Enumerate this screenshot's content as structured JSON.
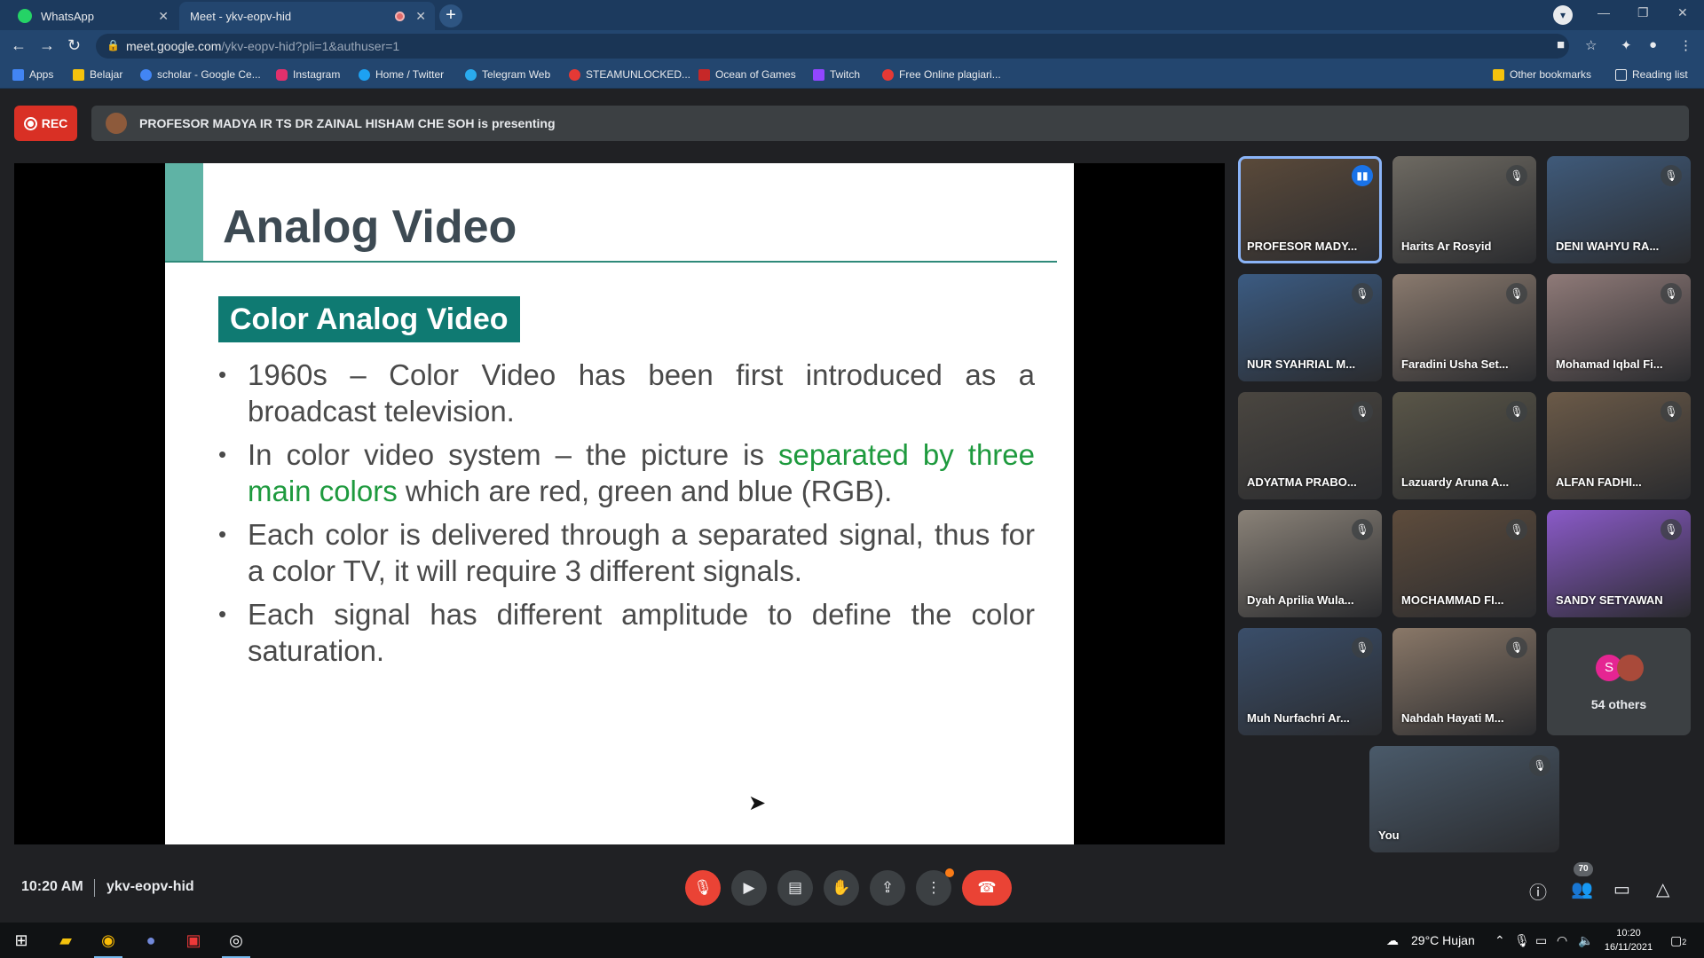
{
  "browser": {
    "tabs": [
      {
        "label": "WhatsApp",
        "active": false
      },
      {
        "label": "Meet - ykv-eopv-hid",
        "active": true
      }
    ],
    "address": {
      "host": "meet.google.com",
      "path": "/ykv-eopv-hid?pli=1&authuser=1"
    },
    "bookmarks": [
      {
        "label": "Apps",
        "color": "#4285f4"
      },
      {
        "label": "Belajar",
        "color": "#f4c20d"
      },
      {
        "label": "scholar - Google Ce...",
        "color": "#4285f4"
      },
      {
        "label": "Instagram",
        "color": "#e1306c"
      },
      {
        "label": "Home / Twitter",
        "color": "#1da1f2"
      },
      {
        "label": "Telegram Web",
        "color": "#2aabee"
      },
      {
        "label": "STEAMUNLOCKED...",
        "color": "#e53935"
      },
      {
        "label": "Ocean of Games",
        "color": "#c62828"
      },
      {
        "label": "Twitch",
        "color": "#9146ff"
      },
      {
        "label": "Free Online plagiari...",
        "color": "#e53935"
      }
    ],
    "other_bookmarks": "Other bookmarks",
    "reading_list": "Reading list"
  },
  "meet": {
    "rec_label": "REC",
    "presenting_text": "PROFESOR MADYA IR TS DR ZAINAL HISHAM CHE SOH is presenting",
    "slide": {
      "title": "Analog Video",
      "subheading": "Color Analog Video",
      "bullets": [
        {
          "text": "1960s – Color Video has been first introduced as a broadcast television."
        },
        {
          "pre": "In color video system – the picture is ",
          "highlight": "separated by three main colors",
          "post": " which are red, green and blue (RGB)."
        },
        {
          "text": "Each color is delivered through a separated signal, thus for a color TV, it will require 3 different signals."
        },
        {
          "text": "Each signal has different amplitude to define the color saturation."
        }
      ]
    },
    "participants": [
      {
        "name": "PROFESOR MADY...",
        "muted": false,
        "speaking": true,
        "bg": "#5b4a3a"
      },
      {
        "name": "Harits Ar Rosyid",
        "muted": true,
        "bg": "#6e6a62"
      },
      {
        "name": "DENI WAHYU RA...",
        "muted": true,
        "bg": "#3f5a7a"
      },
      {
        "name": "NUR SYAHRIAL M...",
        "muted": true,
        "bg": "#3b5b82"
      },
      {
        "name": "Faradini Usha Set...",
        "muted": true,
        "bg": "#8a7a6e"
      },
      {
        "name": "Mohamad Iqbal Fi...",
        "muted": true,
        "bg": "#8f7a78"
      },
      {
        "name": "ADYATMA PRABO...",
        "muted": true,
        "bg": "#4a4640"
      },
      {
        "name": "Lazuardy Aruna A...",
        "muted": true,
        "bg": "#5a5648"
      },
      {
        "name": "ALFAN FADHI...",
        "muted": true,
        "bg": "#6b5a48"
      },
      {
        "name": "Dyah Aprilia Wula...",
        "muted": true,
        "bg": "#8a8278"
      },
      {
        "name": "MOCHAMMAD FI...",
        "muted": true,
        "bg": "#5e4c3c"
      },
      {
        "name": "SANDY SETYAWAN",
        "muted": true,
        "bg": "#8a5ac8"
      },
      {
        "name": "Muh Nurfachri Ar...",
        "muted": true,
        "bg": "#3a4e6a"
      },
      {
        "name": "Nahdah Hayati M...",
        "muted": true,
        "bg": "#8a7868"
      }
    ],
    "others": {
      "label": "54 others",
      "avatar_letter": "S"
    },
    "self": {
      "name": "You",
      "bg": "#4a5a6a"
    },
    "time": "10:20 AM",
    "meeting_code": "ykv-eopv-hid",
    "participant_count": "70"
  },
  "taskbar": {
    "weather": "29°C  Hujan",
    "time": "10:20",
    "date": "16/11/2021",
    "notification_count": "2"
  }
}
